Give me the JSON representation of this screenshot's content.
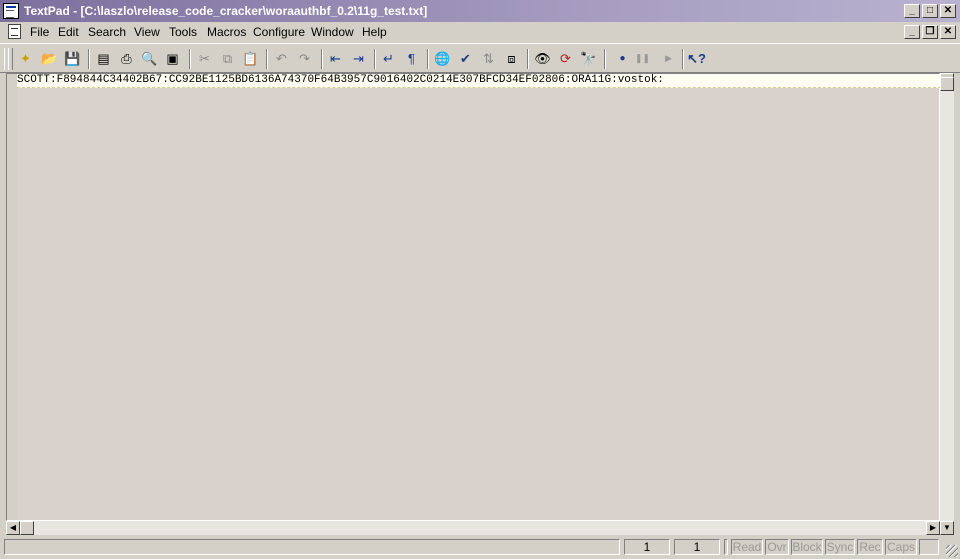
{
  "window": {
    "title": "TextPad - [C:\\laszlo\\release_code_cracker\\woraauthbf_0.2\\11g_test.txt]"
  },
  "menu": [
    "File",
    "Edit",
    "Search",
    "View",
    "Tools",
    "Macros",
    "Configure",
    "Window",
    "Help"
  ],
  "caption_buttons": {
    "minimize": "_",
    "maximize": "□",
    "close": "✕",
    "restore": "❐"
  },
  "toolbar": [
    {
      "name": "new-file-icon",
      "glyph": "✦"
    },
    {
      "name": "open-folder-icon",
      "glyph": "📂"
    },
    {
      "name": "save-icon",
      "glyph": "💾"
    },
    {
      "name": "manage-files-icon",
      "glyph": "▤"
    },
    {
      "name": "print-icon",
      "glyph": "⎙"
    },
    {
      "name": "print-preview-icon",
      "glyph": "🔍"
    },
    {
      "name": "workspace-icon",
      "glyph": "▣"
    },
    {
      "name": "cut-icon",
      "glyph": "✂"
    },
    {
      "name": "copy-icon",
      "glyph": "⧉"
    },
    {
      "name": "paste-icon",
      "glyph": "📋"
    },
    {
      "name": "undo-icon",
      "glyph": "↶"
    },
    {
      "name": "redo-icon",
      "glyph": "↷"
    },
    {
      "name": "decrease-indent-icon",
      "glyph": "⇤"
    },
    {
      "name": "increase-indent-icon",
      "glyph": "⇥"
    },
    {
      "name": "word-wrap-icon",
      "glyph": "↵"
    },
    {
      "name": "visible-spaces-icon",
      "glyph": "¶"
    },
    {
      "name": "web-browser-icon",
      "glyph": "🌐"
    },
    {
      "name": "spell-check-icon",
      "glyph": "✔"
    },
    {
      "name": "sort-icon",
      "glyph": "⇅"
    },
    {
      "name": "compare-icon",
      "glyph": "⧈"
    },
    {
      "name": "find-icon",
      "glyph": "👁"
    },
    {
      "name": "replace-icon",
      "glyph": "⟳"
    },
    {
      "name": "find-in-files-icon",
      "glyph": "🔭"
    },
    {
      "name": "record-macro-icon",
      "glyph": "●"
    },
    {
      "name": "pause-macro-icon",
      "glyph": "❚❚"
    },
    {
      "name": "play-macro-icon",
      "glyph": "▶"
    },
    {
      "name": "context-help-icon",
      "glyph": "↖?"
    }
  ],
  "editor": {
    "line1": "SCOTT:F894844C34402B67:CC92BE1125BD6136A74370F64B3957C9016402C0214E307BFCD34EF02806:ORA11G:vostok:"
  },
  "status": {
    "line": "1",
    "column": "1",
    "read": "Read",
    "ovr": "Ovr",
    "block": "Block",
    "sync": "Sync",
    "rec": "Rec",
    "caps": "Caps"
  }
}
